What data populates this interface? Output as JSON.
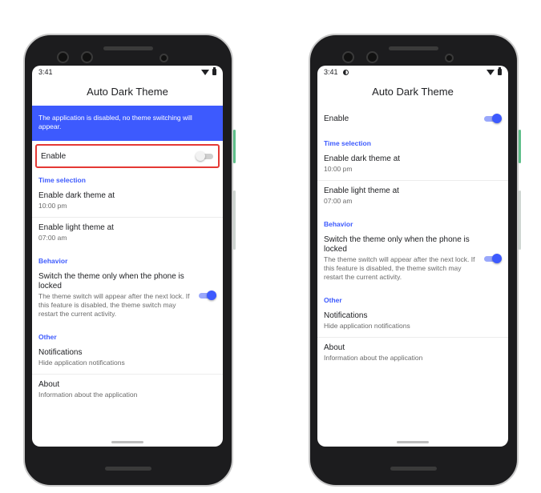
{
  "left": {
    "status": {
      "time": "3:41"
    },
    "title": "Auto Dark Theme",
    "banner": "The application is disabled, no theme switching will appear.",
    "enable": {
      "label": "Enable",
      "state": "off"
    },
    "sections": {
      "time": "Time selection",
      "behavior": "Behavior",
      "other": "Other"
    },
    "items": {
      "dark": {
        "title": "Enable dark theme at",
        "sub": "10:00 pm"
      },
      "light": {
        "title": "Enable light theme at",
        "sub": "07:00 am"
      },
      "switch": {
        "title": "Switch the theme only when the phone is locked",
        "sub": "The theme switch will appear after the next lock. If this feature is disabled, the theme switch may restart the current activity.",
        "state": "on"
      },
      "notifications": {
        "title": "Notifications",
        "sub": "Hide application notifications"
      },
      "about": {
        "title": "About",
        "sub": "Information about the application"
      }
    }
  },
  "right": {
    "status": {
      "time": "3:41"
    },
    "title": "Auto Dark Theme",
    "enable": {
      "label": "Enable",
      "state": "on"
    },
    "sections": {
      "time": "Time selection",
      "behavior": "Behavior",
      "other": "Other"
    },
    "items": {
      "dark": {
        "title": "Enable dark theme at",
        "sub": "10:00 pm"
      },
      "light": {
        "title": "Enable light theme at",
        "sub": "07:00 am"
      },
      "switch": {
        "title": "Switch the theme only when the phone is locked",
        "sub": "The theme switch will appear after the next lock. If this feature is disabled, the theme switch may restart the current activity.",
        "state": "on"
      },
      "notifications": {
        "title": "Notifications",
        "sub": "Hide application notifications"
      },
      "about": {
        "title": "About",
        "sub": "Information about the application"
      }
    }
  },
  "colors": {
    "accent": "#3d5afe",
    "highlight_border": "#e53935"
  },
  "icons": [
    "wifi-icon",
    "battery-icon",
    "dark-mode-status-icon"
  ]
}
